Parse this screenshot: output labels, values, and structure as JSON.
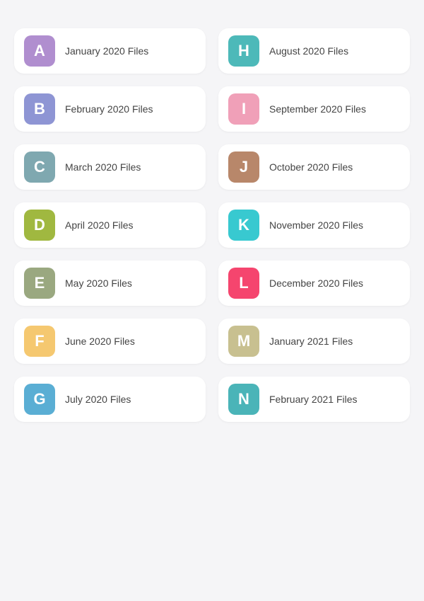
{
  "folders": [
    {
      "id": "A",
      "label": "January 2020 Files",
      "color": "#b08ecf"
    },
    {
      "id": "H",
      "label": "August 2020 Files",
      "color": "#4db9b9"
    },
    {
      "id": "B",
      "label": "February 2020 Files",
      "color": "#8e95d4"
    },
    {
      "id": "I",
      "label": "September 2020 Files",
      "color": "#f0a0b8"
    },
    {
      "id": "C",
      "label": "March 2020 Files",
      "color": "#7fa8b0"
    },
    {
      "id": "J",
      "label": "October 2020 Files",
      "color": "#b8876a"
    },
    {
      "id": "D",
      "label": "April 2020 Files",
      "color": "#a0b840"
    },
    {
      "id": "K",
      "label": "November 2020 Files",
      "color": "#38c9d0"
    },
    {
      "id": "E",
      "label": "May 2020 Files",
      "color": "#9aa880"
    },
    {
      "id": "L",
      "label": "December 2020 Files",
      "color": "#f5456e"
    },
    {
      "id": "F",
      "label": "June 2020 Files",
      "color": "#f5c870"
    },
    {
      "id": "M",
      "label": "January 2021 Files",
      "color": "#c8c090"
    },
    {
      "id": "G",
      "label": "July 2020 Files",
      "color": "#5aaed4"
    },
    {
      "id": "N",
      "label": "February 2021 Files",
      "color": "#4ab4b8"
    }
  ]
}
